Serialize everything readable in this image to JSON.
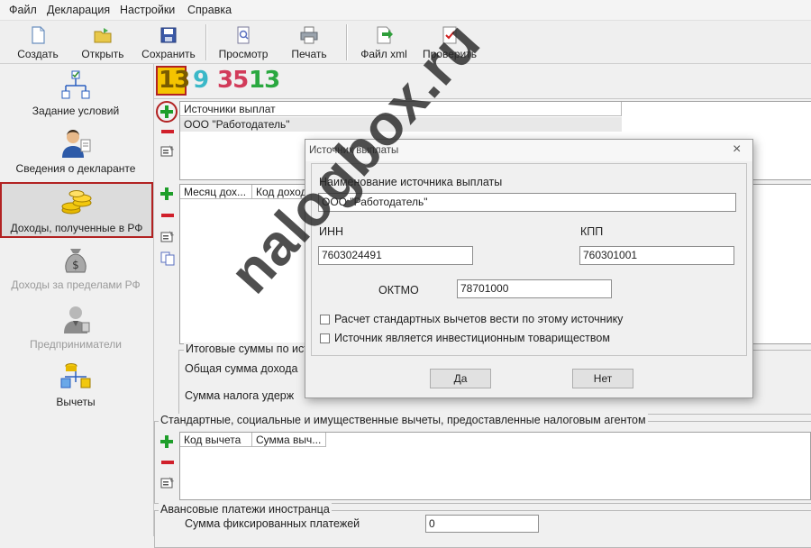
{
  "menu": [
    "Файл",
    "Декларация",
    "Настройки",
    "Справка"
  ],
  "toolbar": {
    "create": "Создать",
    "open": "Открыть",
    "save": "Сохранить",
    "preview": "Просмотр",
    "print": "Печать",
    "xml": "Файл xml",
    "check": "Проверить"
  },
  "sidebar": {
    "items": [
      {
        "label": "Задание условий",
        "icon": "conditions-icon",
        "enabled": true
      },
      {
        "label": "Сведения о декларанте",
        "icon": "declarant-icon",
        "enabled": true
      },
      {
        "label": "Доходы, полученные в РФ",
        "icon": "coins-icon",
        "enabled": true,
        "selected": true
      },
      {
        "label": "Доходы за пределами РФ",
        "icon": "money-bag-icon",
        "enabled": false
      },
      {
        "label": "Предприниматели",
        "icon": "entrepreneur-icon",
        "enabled": false
      },
      {
        "label": "Вычеты",
        "icon": "deductions-icon",
        "enabled": true
      }
    ]
  },
  "rate_tabs": [
    "13",
    "9",
    "35",
    "13"
  ],
  "sources": {
    "header": "Источники выплат",
    "rows": [
      "ООО \"Работодатель\""
    ]
  },
  "income": {
    "col_month": "Месяц дох...",
    "col_code": "Код доход"
  },
  "totals": {
    "title": "Итоговые суммы по ист",
    "total_income": "Общая сумма дохода",
    "tax_withheld": "Сумма налога удерж"
  },
  "deductions": {
    "title": "Стандартные, социальные и имущественные вычеты, предоставленные налоговым агентом",
    "col_code": "Код вычета",
    "col_sum": "Сумма выч..."
  },
  "advance": {
    "title": "Авансовые платежи иностранца",
    "label": "Сумма фиксированных платежей",
    "value": "0"
  },
  "dialog": {
    "title": "Источник выплаты",
    "name_label": "Наименование источника выплаты",
    "name_value": "ООО \"Работодатель\"",
    "inn_label": "ИНН",
    "inn_value": "7603024491",
    "kpp_label": "КПП",
    "kpp_value": "760301001",
    "oktmo_label": "ОКТМО",
    "oktmo_value": "78701000",
    "check1": "Расчет стандартных вычетов вести по этому источнику",
    "check2": "Источник является инвестиционным товариществом",
    "yes": "Да",
    "no": "Нет"
  },
  "watermark": "nalogbox.ru",
  "colors": {
    "selection_border": "#b22222",
    "add_green": "#1e9e2a",
    "remove_red": "#d01f2a"
  }
}
